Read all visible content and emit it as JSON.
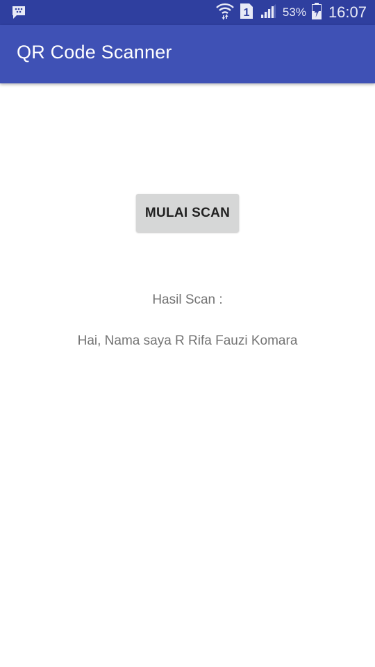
{
  "status_bar": {
    "battery_percent": "53%",
    "time": "16:07",
    "sim_slot": "1",
    "icons": [
      "bbm-notification-icon",
      "wifi-icon",
      "sim-icon",
      "signal-icon",
      "battery-icon"
    ],
    "color": "#2f3f9f"
  },
  "app_bar": {
    "title": "QR Code Scanner",
    "color": "#3f51b5"
  },
  "main": {
    "scan_button_label": "MULAI SCAN",
    "result_label": "Hasil Scan :",
    "result_value": "Hai, Nama saya R Rifa Fauzi Komara"
  }
}
